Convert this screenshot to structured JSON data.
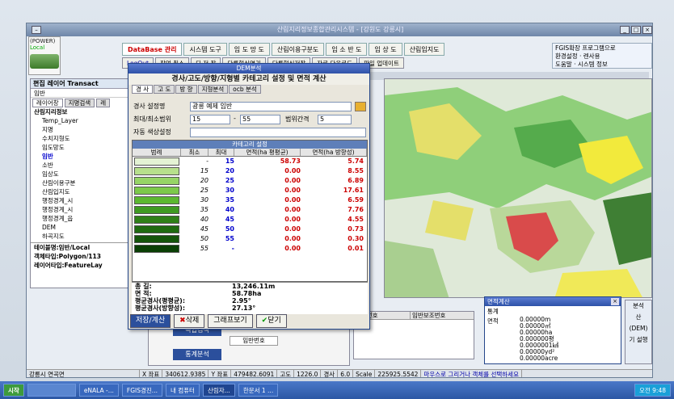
{
  "window_title": "산림지리정보종합관리시스템 - [강원도 강릉시]",
  "power": {
    "label": "(POWER)",
    "sub": "Local"
  },
  "menus": [
    "DataBase 관리",
    "시스템 도구",
    "임 도 망 도",
    "산림이용구분도",
    "임 소 반 도",
    "임 상 도",
    "산림입지도"
  ],
  "tools": [
    "LogOut",
    "작업 취소",
    "되 저 장",
    "다른형식열기",
    "다른형식저장",
    "자료 다운로드",
    "파일 업데이트"
  ],
  "right_links": [
    "FGIS확장 프로그램으로",
    "환경설정",
    "렌사용",
    "도움말",
    "시스템 정보"
  ],
  "layer_panel": {
    "title": "편집 레이어 Transact",
    "sub": "임반",
    "tabs": [
      "레이어창",
      "지명검색",
      "레"
    ],
    "items": [
      "산림지리정보",
      "Temp_Layer",
      "지명",
      "수치지형도",
      "임도망도",
      "임반",
      "소반",
      "임상도",
      "산림이용구분",
      "산림입지도",
      "행정경계_시",
      "행정경계_시",
      "행정경계_읍",
      "DEM",
      "하곡지도"
    ],
    "info": [
      "테이블명:임반/Local",
      "객체타입:Polygon/113",
      "레이어타입:FeatureLay"
    ]
  },
  "dialog": {
    "title": "DEM분석",
    "heading": "경사/고도/방향/지형별 카테고리 설정 및 면적 계산",
    "tabs": [
      "경 사",
      "고 도",
      "방 향",
      "지형분석",
      "ocb 분석"
    ],
    "slope_label": "경사 설정명",
    "slope_value": "광릉 예제 임반",
    "range_label": "최대/최소범위",
    "range_min": "15",
    "range_max": "55",
    "interval_label": "범위간격",
    "interval_value": "5",
    "auto_label": "자동 색상설정",
    "table_title": "카테고리 설정",
    "cols": [
      "범례",
      "최소",
      "최대",
      "면적(ha 평평균)",
      "면적(ha 방향성)"
    ],
    "rows": [
      {
        "min": "-",
        "max": "15",
        "a": "58.73",
        "b": "5.74",
        "color": "#e4f2d4"
      },
      {
        "min": "15",
        "max": "20",
        "a": "0.00",
        "b": "8.55",
        "color": "#b7e08c"
      },
      {
        "min": "20",
        "max": "25",
        "a": "0.00",
        "b": "6.89",
        "color": "#96d466"
      },
      {
        "min": "25",
        "max": "30",
        "a": "0.00",
        "b": "17.61",
        "color": "#7cc94a"
      },
      {
        "min": "30",
        "max": "35",
        "a": "0.00",
        "b": "6.59",
        "color": "#5cb830"
      },
      {
        "min": "35",
        "max": "40",
        "a": "0.00",
        "b": "7.76",
        "color": "#3f9a22"
      },
      {
        "min": "40",
        "max": "45",
        "a": "0.00",
        "b": "4.55",
        "color": "#2f8018"
      },
      {
        "min": "45",
        "max": "50",
        "a": "0.00",
        "b": "0.73",
        "color": "#1f6a10"
      },
      {
        "min": "50",
        "max": "55",
        "a": "0.00",
        "b": "0.30",
        "color": "#14540a"
      },
      {
        "min": "55",
        "max": "-",
        "a": "0.00",
        "b": "0.01",
        "color": "#0a3f05"
      }
    ],
    "summary": [
      {
        "label": "총 길:",
        "value": "13,246.11m"
      },
      {
        "label": "면 적:",
        "value": "58.78ha"
      },
      {
        "label": "평균경사(평평균):",
        "value": "2.95°"
      },
      {
        "label": "평균경사(방향성):",
        "value": "27.13°"
      }
    ],
    "buttons": [
      "저장/계산",
      "삭제",
      "그래프보기",
      "닫기"
    ]
  },
  "area_panel": {
    "title": "면적계산",
    "unit_label": "통계",
    "area_label": "면적",
    "values": [
      "0.00000m",
      "0.00000㎡",
      "0.00000ha",
      "0.000000평",
      "0.0000001㎢",
      "0.00000yd²",
      "0.00000acre"
    ]
  },
  "bottom_panel": {
    "cols": [
      "임반번호",
      "임반보조번호"
    ],
    "labels": [
      "복합검색",
      "임반번호",
      "통계분석"
    ],
    "right_labels": [
      "분석",
      "산",
      "(DEM)",
      "기 설행"
    ]
  },
  "statusbar": [
    "강릉시 연곡면",
    "X 좌표",
    "340612.9385",
    "Y 좌표",
    "479482.6091",
    "고도",
    "1226.0",
    "경사",
    "6.0",
    "Scale",
    "225925.5542",
    "마우스로 그리거나 객체를 선택하세요"
  ],
  "taskbar": {
    "start": "시작",
    "items": [
      "eNALA -...",
      "FGIS경진...",
      "내 컴퓨터",
      "산림자...",
      "한문서 1 ..."
    ],
    "clock": "오전 9:48"
  }
}
